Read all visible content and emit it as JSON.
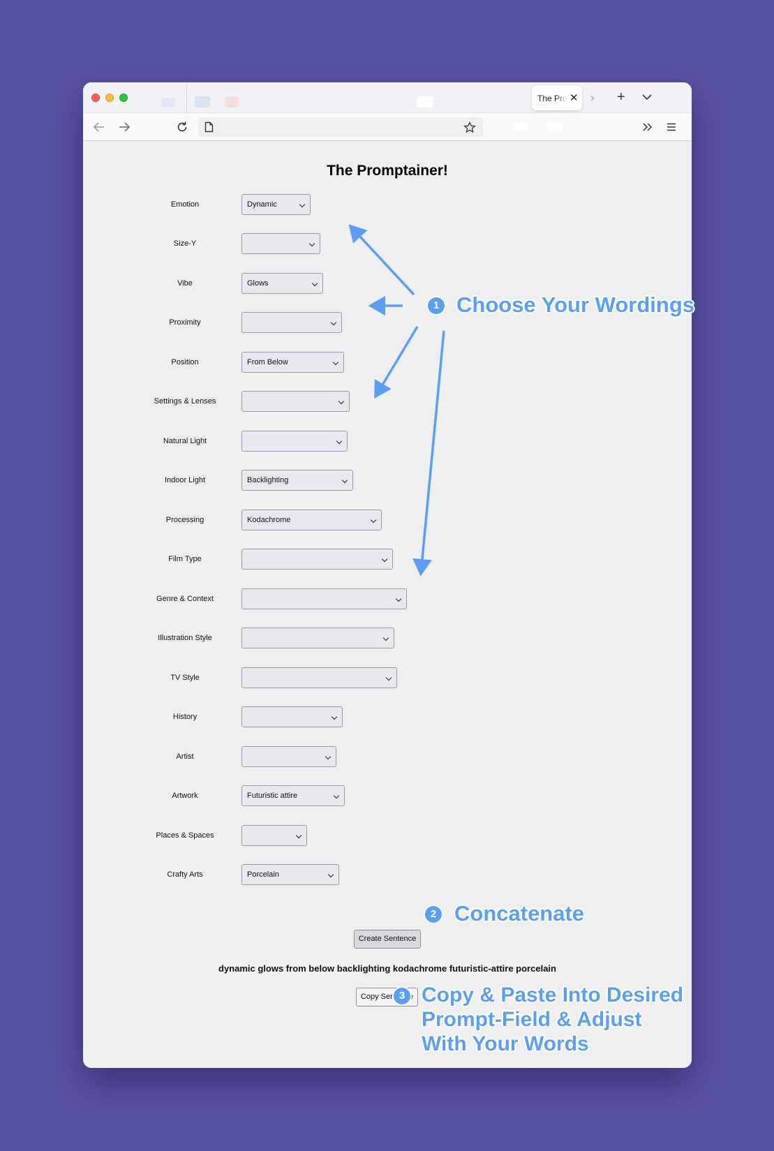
{
  "browser": {
    "tab_title": "The Promptainer!",
    "address": ""
  },
  "page": {
    "title": "The Promptainer!",
    "rows": [
      {
        "label": "Emotion",
        "value": "Dynamic"
      },
      {
        "label": "Size-Y",
        "value": ""
      },
      {
        "label": "Vibe",
        "value": "Glows"
      },
      {
        "label": "Proximity",
        "value": ""
      },
      {
        "label": "Position",
        "value": "From Below"
      },
      {
        "label": "Settings & Lenses",
        "value": ""
      },
      {
        "label": "Natural Light",
        "value": ""
      },
      {
        "label": "Indoor Light",
        "value": "Backlighting"
      },
      {
        "label": "Processing",
        "value": "Kodachrome"
      },
      {
        "label": "Film Type",
        "value": ""
      },
      {
        "label": "Genre & Context",
        "value": ""
      },
      {
        "label": "Illustration Style",
        "value": ""
      },
      {
        "label": "TV Style",
        "value": ""
      },
      {
        "label": "History",
        "value": ""
      },
      {
        "label": "Artist",
        "value": ""
      },
      {
        "label": "Artwork",
        "value": "Futuristic attire"
      },
      {
        "label": "Places & Spaces",
        "value": ""
      },
      {
        "label": "Crafty Arts",
        "value": "Porcelain"
      }
    ],
    "create_button": "Create Sentence",
    "sentence": "dynamic glows from below backlighting kodachrome futuristic-attire porcelain",
    "copy_button": "Copy Sentence"
  },
  "annotations": {
    "step1_number": "1",
    "step1_text": "Choose Your Wordings",
    "step2_number": "2",
    "step2_text": "Concatenate",
    "step3_number": "3",
    "step3_lines": [
      "Copy & Paste Into Desired",
      "Prompt-Field & Adjust",
      "With Your Words"
    ]
  },
  "colors": {
    "background": "#5852a2",
    "annotation_blue": "#5b9ef5"
  }
}
